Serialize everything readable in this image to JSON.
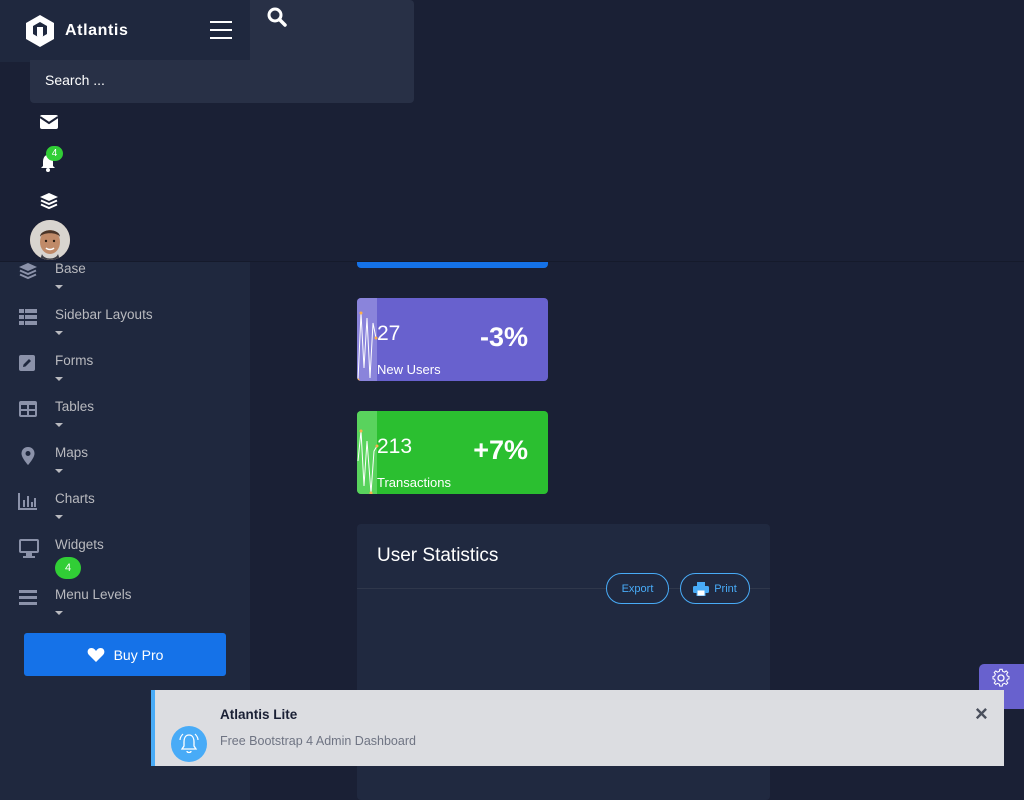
{
  "brand": {
    "name": "Atlantis"
  },
  "search": {
    "placeholder": "Search ..."
  },
  "notifications": {
    "count": "4"
  },
  "sidebar": {
    "items": [
      {
        "label": "Base",
        "icon": "layers-icon"
      },
      {
        "label": "Sidebar Layouts",
        "icon": "th-list-icon"
      },
      {
        "label": "Forms",
        "icon": "pen-square-icon"
      },
      {
        "label": "Tables",
        "icon": "table-icon"
      },
      {
        "label": "Maps",
        "icon": "map-marker-icon"
      },
      {
        "label": "Charts",
        "icon": "chart-bar-icon"
      },
      {
        "label": "Widgets",
        "icon": "desktop-icon",
        "badge": "4"
      },
      {
        "label": "Menu Levels",
        "icon": "bars-icon"
      }
    ],
    "buy_pro": "Buy Pro"
  },
  "cards": [
    {
      "value": "27",
      "label": "New Users",
      "change": "-3%",
      "color": "#6861ce"
    },
    {
      "value": "213",
      "label": "Transactions",
      "change": "+7%",
      "color": "#31ce36"
    }
  ],
  "stats": {
    "title": "User Statistics",
    "export": "Export",
    "print": "Print"
  },
  "toast": {
    "title": "Atlantis Lite",
    "message": "Free Bootstrap 4 Admin Dashboard"
  },
  "colors": {
    "primary": "#1572e8",
    "secondary": "#6861ce",
    "success": "#31ce36",
    "info": "#48abf7",
    "bg": "#1a2035",
    "sidebar": "#1f283e"
  }
}
